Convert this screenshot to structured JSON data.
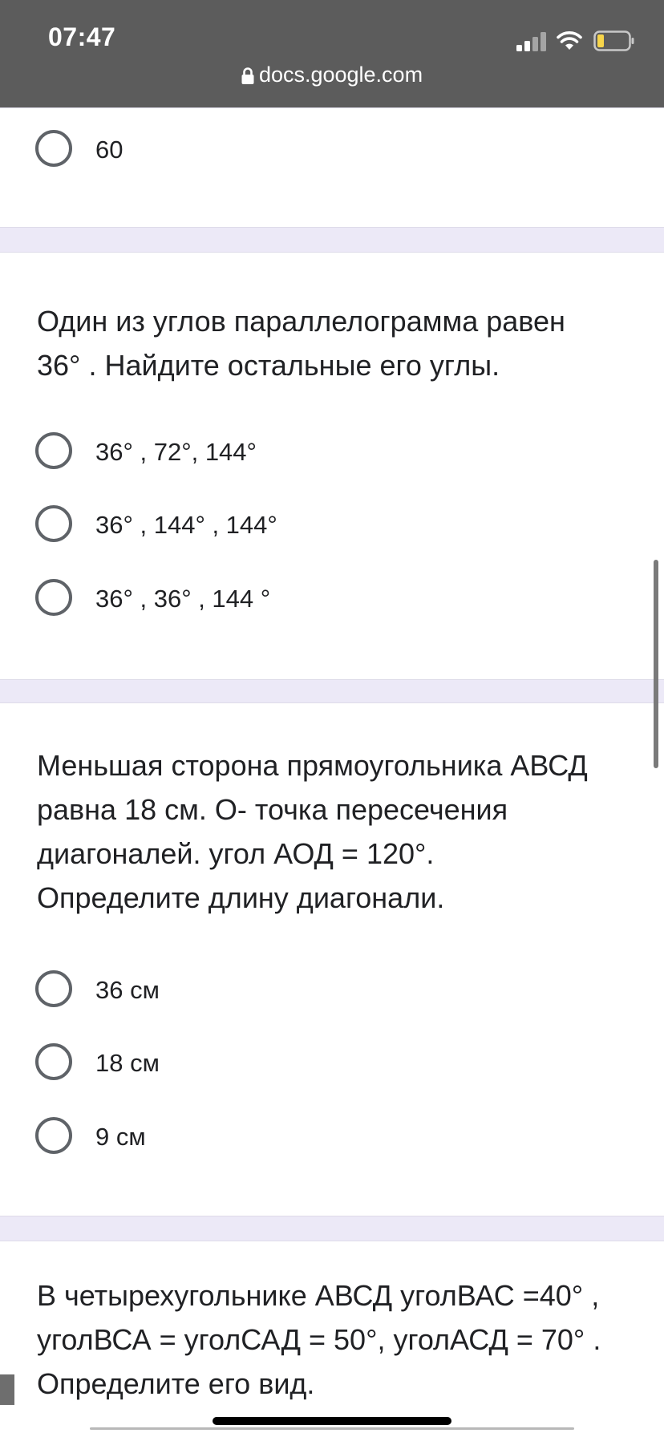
{
  "status_bar": {
    "time": "07:47",
    "url": "docs.google.com"
  },
  "colors": {
    "status_bar_bg": "#5c5c5c",
    "page_bg": "#ece9f7",
    "radio_border": "#5f6368",
    "text": "#202124"
  },
  "top_card": {
    "options": [
      {
        "label": "60"
      }
    ]
  },
  "questions": [
    {
      "text_lines": [
        "Один из углов параллелограмма равен",
        "36° . Найдите остальные его углы."
      ],
      "options": [
        {
          "label": "36° , 72°, 144°"
        },
        {
          "label": "36° , 144° , 144°"
        },
        {
          "label": "36° , 36° , 144 °"
        }
      ]
    },
    {
      "text_lines": [
        "Меньшая сторона прямоугольника АВСД",
        "равна 18 см. О- точка пересечения",
        "диагоналей. угол АОД = 120°.",
        "Определите длину диагонали."
      ],
      "options": [
        {
          "label": "36 см"
        },
        {
          "label": "18 см"
        },
        {
          "label": "9 см"
        }
      ]
    },
    {
      "text_lines": [
        "В четырехугольнике АВСД уголВАС =40° ,",
        "уголВСА = уголСАД = 50°, уголАСД = 70° .",
        "Определите его вид."
      ],
      "options": []
    }
  ]
}
